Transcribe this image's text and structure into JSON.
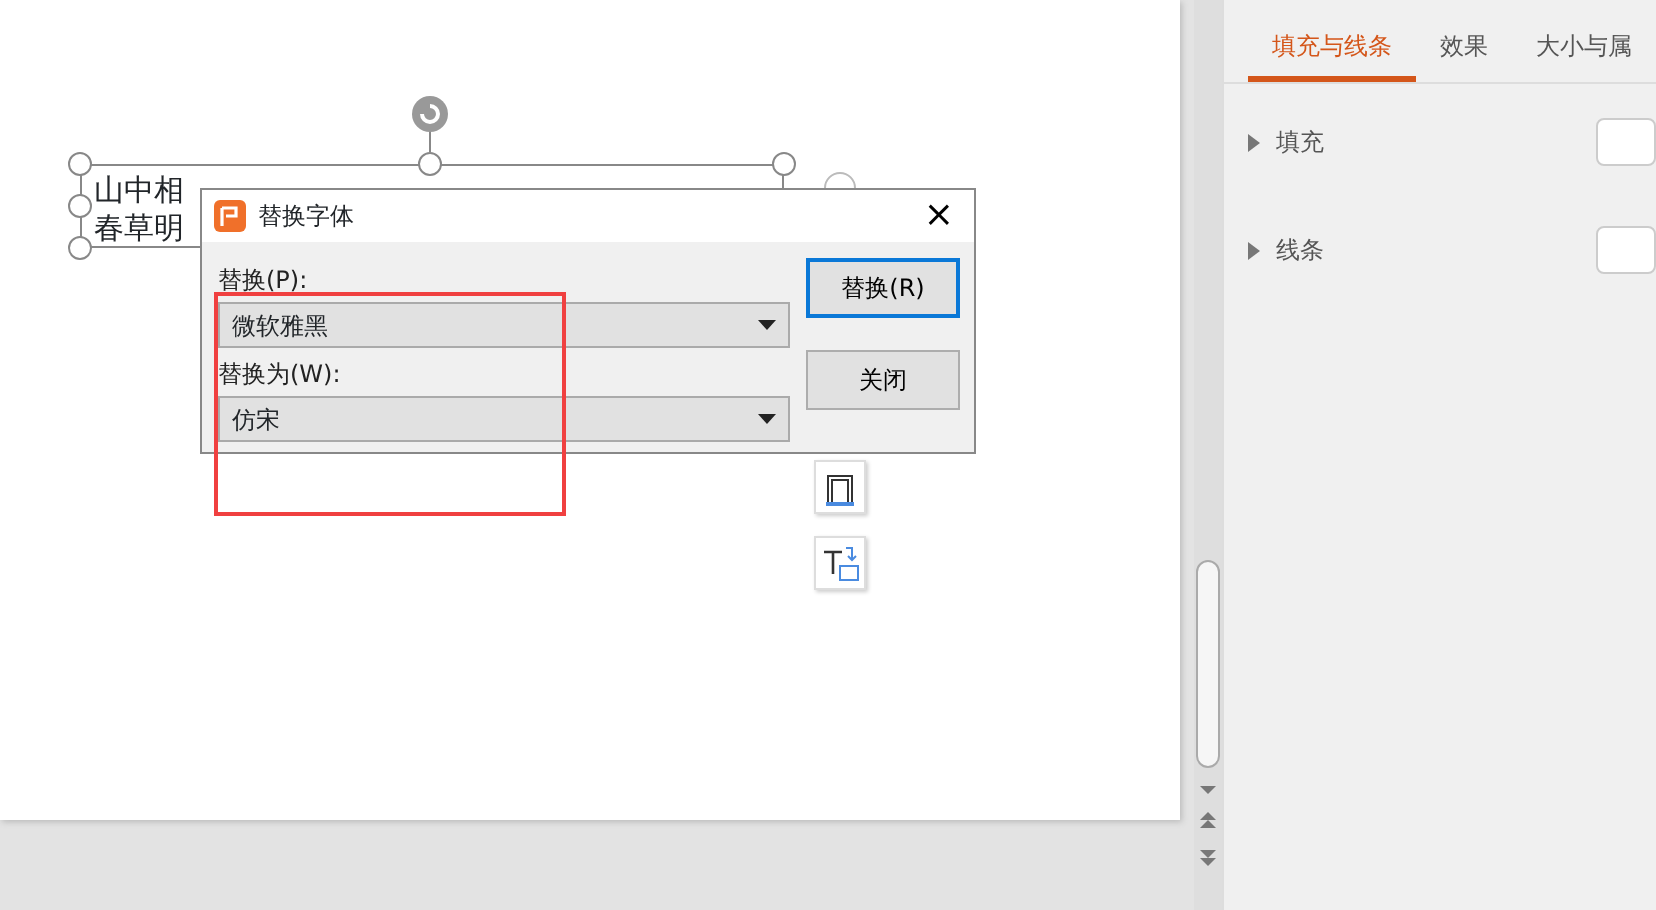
{
  "slide": {
    "text_lines": [
      "山中相",
      "春草明"
    ]
  },
  "dialog": {
    "title": "替换字体",
    "close": "×",
    "fields": [
      {
        "label": "替换(P):",
        "value": "微软雅黑"
      },
      {
        "label": "替换为(W):",
        "value": "仿宋"
      }
    ],
    "buttons": [
      {
        "label": "替换(R)",
        "selected": true
      },
      {
        "label": "关闭",
        "selected": false
      }
    ]
  },
  "panel": {
    "tabs": [
      {
        "label": "填充与线条",
        "selected": true
      },
      {
        "label": "效果",
        "selected": false
      },
      {
        "label": "大小与属",
        "selected": false
      }
    ],
    "sections": [
      {
        "label": "填充",
        "expanded": false
      },
      {
        "label": "线条",
        "expanded": false
      }
    ]
  }
}
